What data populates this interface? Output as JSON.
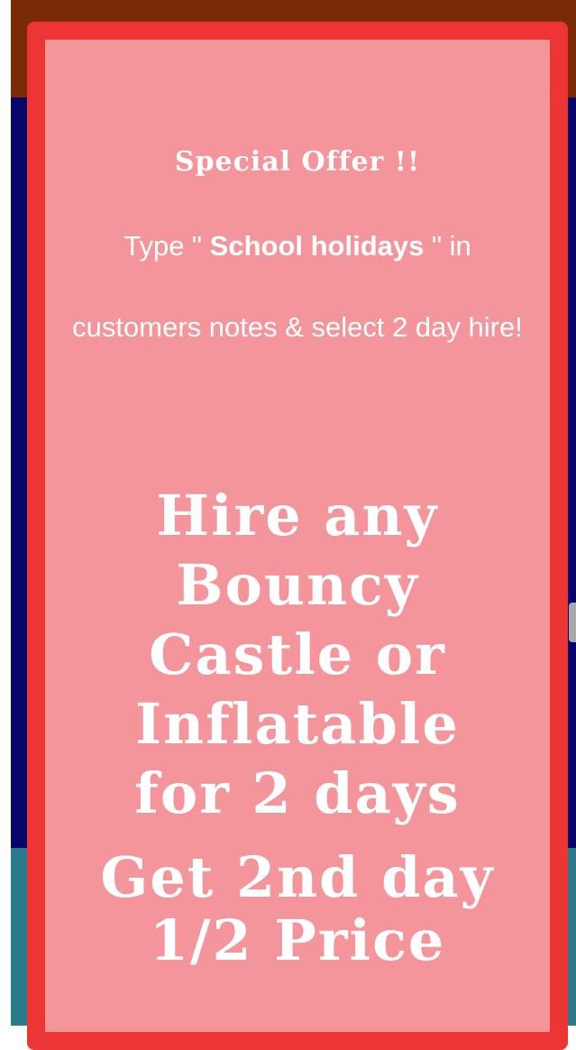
{
  "popup": {
    "title": "Special Offer !!",
    "instructions": {
      "prefix": "Type \" ",
      "code": "School holidays",
      "suffix": " \" in customers notes & select 2 day hire!"
    },
    "headline": "Hire any Bouncy Castle or Inflatable for 2 days",
    "subheadline": "Get 2nd day 1/2 Price"
  },
  "colors": {
    "popup_border": "#ee3535",
    "popup_fill": "#f3959b",
    "text": "#ffffff",
    "page_header": "#7a2a06",
    "page_body": "#07056a",
    "page_footer": "#2a7a8a"
  }
}
